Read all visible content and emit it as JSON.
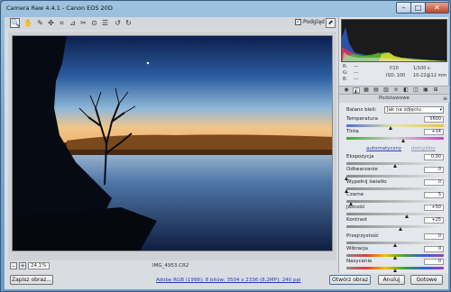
{
  "window": {
    "title": "Camera Raw 4.4.1  -  Canon EOS 20D",
    "min_glyph": "–",
    "max_glyph": "□",
    "close_glyph": "✕"
  },
  "toolbar": {
    "tools": [
      {
        "name": "zoom-tool",
        "glyph": "🔍"
      },
      {
        "name": "hand-tool",
        "glyph": "✋"
      },
      {
        "name": "white-balance-tool",
        "glyph": "✎"
      },
      {
        "name": "color-sampler-tool",
        "glyph": "✜"
      },
      {
        "name": "crop-tool",
        "glyph": "⌗"
      },
      {
        "name": "straighten-tool",
        "glyph": "⊿"
      },
      {
        "name": "spot-removal-tool",
        "glyph": "✂"
      },
      {
        "name": "red-eye-tool",
        "glyph": "⊙"
      },
      {
        "name": "preferences-tool",
        "glyph": "☰"
      },
      {
        "name": "rotate-left-tool",
        "glyph": "↺"
      },
      {
        "name": "rotate-right-tool",
        "glyph": "↻"
      }
    ],
    "preview_label": "Podgląd",
    "preview_checked": "✓",
    "fullscreen_glyph": "⬈"
  },
  "zoom": {
    "minus": "–",
    "plus": "+",
    "value": "24,1%"
  },
  "filename": "IMG_4953.CR2",
  "bottom": {
    "save_label": "Zapisz obraz...",
    "workflow_link": "Adobe RGB (1998); 8 bitów; 3504 x 2336 (8,2MP); 240 ppi",
    "open_label": "Otwórz obraz",
    "cancel_label": "Anuluj",
    "done_label": "Gotowe"
  },
  "info": {
    "r_label": "R:",
    "g_label": "G:",
    "b_label": "B:",
    "r_val": "---",
    "g_val": "---",
    "b_val": "---",
    "aperture": "f/10",
    "shutter": "1/100 s",
    "iso": "ISO: 100",
    "lens": "10-22@12 mm"
  },
  "panel": {
    "title": "Podstawowe",
    "menu_glyph": "≡",
    "tabs": [
      "◉",
      "◭",
      "▦",
      "▤",
      "▥",
      "≋",
      "◧",
      "◫",
      "▣",
      "⊞"
    ],
    "wb_label": "Balans bieli:",
    "wb_value": "Jak na zdjęciu",
    "wb_arrow": "▾",
    "auto_label": "automatyczny",
    "default_label": "domyślny",
    "auto_color": "#2a46b8",
    "default_color": "#8a8fb8",
    "sliders": [
      {
        "label": "Temperatura",
        "value": "5600",
        "level": 0.45,
        "track": "temp"
      },
      {
        "label": "Tinta",
        "value": "+14",
        "level": 0.58,
        "track": "tint"
      },
      {
        "label": "Ekspozycja",
        "value": "0,00",
        "level": 0.5,
        "track": "gray"
      },
      {
        "label": "Odtwarzanie",
        "value": "0",
        "level": 0.0,
        "track": "gray"
      },
      {
        "label": "Wypełnij światło",
        "value": "0",
        "level": 0.0,
        "track": "gray"
      },
      {
        "label": "Czarne",
        "value": "5",
        "level": 0.05,
        "track": "gray"
      },
      {
        "label": "Jasność",
        "value": "+50",
        "level": 0.62,
        "track": "gray"
      },
      {
        "label": "Kontrast",
        "value": "+25",
        "level": 0.56,
        "track": "gray"
      },
      {
        "label": "Przejrzystość",
        "value": "0",
        "level": 0.5,
        "track": "gray"
      },
      {
        "label": "Wibracja",
        "value": "0",
        "level": 0.5,
        "track": "sat"
      },
      {
        "label": "Nasycenie",
        "value": "0",
        "level": 0.5,
        "track": "sat"
      }
    ]
  },
  "colors": {
    "temp_track": "linear-gradient(90deg,#4a6fd6,#e8e8a0,#e9c23c)",
    "tint_track": "linear-gradient(90deg,#3fa83f,#d0d0d0,#c048c0)",
    "gray_track": "linear-gradient(90deg,#8a8a8a,#e8e8e8)",
    "sat_track": "linear-gradient(90deg,#8a8a8a,#e23b3b,#f0c000,#3aa03a,#3060e0,#a040c0)"
  }
}
